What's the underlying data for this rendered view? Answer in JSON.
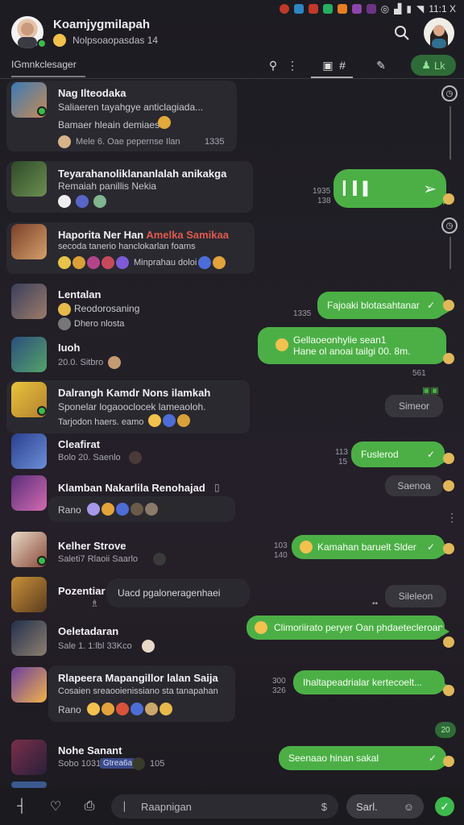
{
  "status_bar": {
    "time": "11:1 X",
    "icons": [
      "notification-icon",
      "app-icon",
      "app-icon",
      "app-icon",
      "app-icon",
      "app-icon",
      "app-icon",
      "sync-icon",
      "signal-icon",
      "battery-icon",
      "wifi-icon"
    ]
  },
  "header": {
    "title": "Koamjygmilapah",
    "subtitle": "Nolpsoaopasdas 14"
  },
  "toolbar": {
    "label": "IGmnkclesager",
    "pill_label": "Lk"
  },
  "chats": [
    {
      "title": "Nag Ilteodaka",
      "line1": "Saliaeren tayahgye anticlagiada...",
      "line2": "Bamaer hleain demiaes",
      "meta": "Mele 6. Oae pepernse  Ilan",
      "meta_time": "1335"
    },
    {
      "title": "Teyarahanoliklananlalah anikakga",
      "line1": "Remaiah panillis Nekia",
      "out_time": "1935",
      "out_time2": "138"
    },
    {
      "title": "Haporita Ner Han",
      "title_red": "Amelka Samikaa",
      "line1": "secoda tanerio hanclokarlan foams",
      "line2": "Minprahau doloi"
    },
    {
      "title": "Lentalan",
      "line1": "Reodorosaning",
      "line2": "Dhero nlosta",
      "out_text": "Fajoaki blotasahtanar",
      "out_time": "1335"
    },
    {
      "title": "Iuoh",
      "meta": "20.0. Sitbro",
      "out_text1": "Gellaoeonhylie sean1",
      "out_text2": "Hane ol anoai tailgi 00. 8m.",
      "out_time": "561"
    },
    {
      "title": "Dalrangh Kamdr Nons ilamkah",
      "line1": "Sponelar logaooclocek lameaoloh.",
      "line2": "Tarjodon haers. eamo",
      "gray_text": "Simeor"
    },
    {
      "title": "Cleafirat",
      "meta": "Bolo 20.  Saenlo",
      "out_text": "Fuslerod",
      "out_time": "113",
      "out_time2": "15"
    },
    {
      "title": "Klamban Nakarlila Renohajad",
      "line1": "Rano",
      "gray_text": "Saenoa"
    },
    {
      "title": "Kelher Strove",
      "meta": "Saleti7 Rlaoii Saarlo",
      "out_text": "Kamahan baruelt Slder",
      "out_time": "103",
      "out_time2": "140"
    },
    {
      "title": "Pozentiar",
      "gray_text_in": "Uacd pgaloneragenhaei",
      "gray_text": "Sileleon"
    },
    {
      "title": "Oeletadaran",
      "meta": "Sale 1.  1:lbl  33Kco",
      "out_text": "Climoriirato peryer Oan phdaetecleroan"
    },
    {
      "title": "Rlapeera Mapangillor lalan Saija",
      "line1": "Cosaien sreaooienissiano sta tanapahan",
      "line2": "Rano",
      "out_text": "Ihaltapeadrialar kertecoelt...",
      "out_time": "300",
      "out_time2": "326"
    },
    {
      "title": "Nohe Sanant",
      "meta": "Sobo 1031",
      "tag": "Gtrea6a",
      "meta2": "105",
      "out_text": "Seenaao hinan sakal",
      "badge": "20"
    }
  ],
  "bottom_bar": {
    "input_placeholder": "Raapnigan",
    "send_label": "Sarl."
  },
  "colors": {
    "accent_green": "#4caf46",
    "background": "#1f1d23",
    "incoming_bubble": "#2a2930",
    "tag_blue": "#3a4a8a"
  }
}
